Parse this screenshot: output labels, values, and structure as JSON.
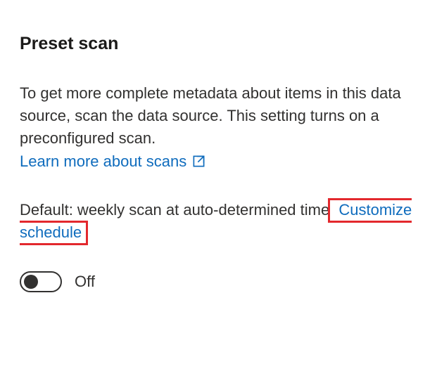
{
  "heading": "Preset scan",
  "description": "To get more complete metadata about items in this data source, scan the data source. This setting turns on a preconfigured scan.",
  "learn_more_link": "Learn more about scans",
  "schedule": {
    "prefix": "Default: weekly scan at auto-determined time",
    "customize_link": "Customize schedule"
  },
  "toggle": {
    "state": "off",
    "label": "Off"
  }
}
